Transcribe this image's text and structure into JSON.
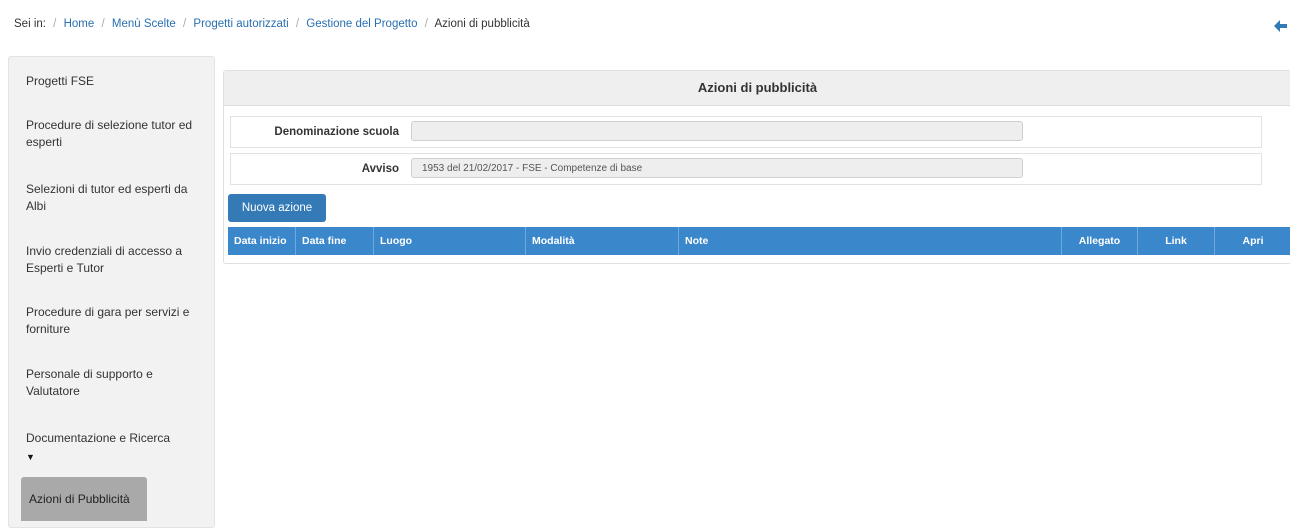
{
  "breadcrumb": {
    "prefix": "Sei in:",
    "items": [
      "Home",
      "Menù Scelte",
      "Progetti autorizzati",
      "Gestione del Progetto"
    ],
    "current": "Azioni di pubblicità",
    "separator": "/"
  },
  "back_icon": "arrow-left-icon",
  "sidebar": {
    "items": [
      {
        "label": "Progetti FSE"
      },
      {
        "label": "Procedure di selezione tutor ed esperti"
      },
      {
        "label": "Selezioni di tutor ed esperti da Albi"
      },
      {
        "label": "Invio credenziali di accesso a Esperti e Tutor"
      },
      {
        "label": "Procedure di gara per servizi e forniture"
      },
      {
        "label": "Personale di supporto e Valutatore"
      },
      {
        "label": "Documentazione e Ricerca"
      },
      {
        "label": "Azioni di Pubblicità"
      }
    ],
    "caret_glyph": "▼"
  },
  "panel": {
    "title": "Azioni di pubblicità",
    "fields": [
      {
        "label": "Denominazione scuola",
        "value": ""
      },
      {
        "label": "Avviso",
        "value": "1953  del 21/02/2017 - FSE - Competenze di base"
      }
    ],
    "new_button": "Nuova azione",
    "columns": [
      "Data inizio",
      "Data fine",
      "Luogo",
      "Modalità",
      "Note",
      "Allegato",
      "Link",
      "Apri"
    ]
  },
  "colors": {
    "primary": "#337ab7",
    "table_header": "#3a87cc",
    "active_item": "#a9a9a9",
    "link": "#2a6fb0"
  }
}
